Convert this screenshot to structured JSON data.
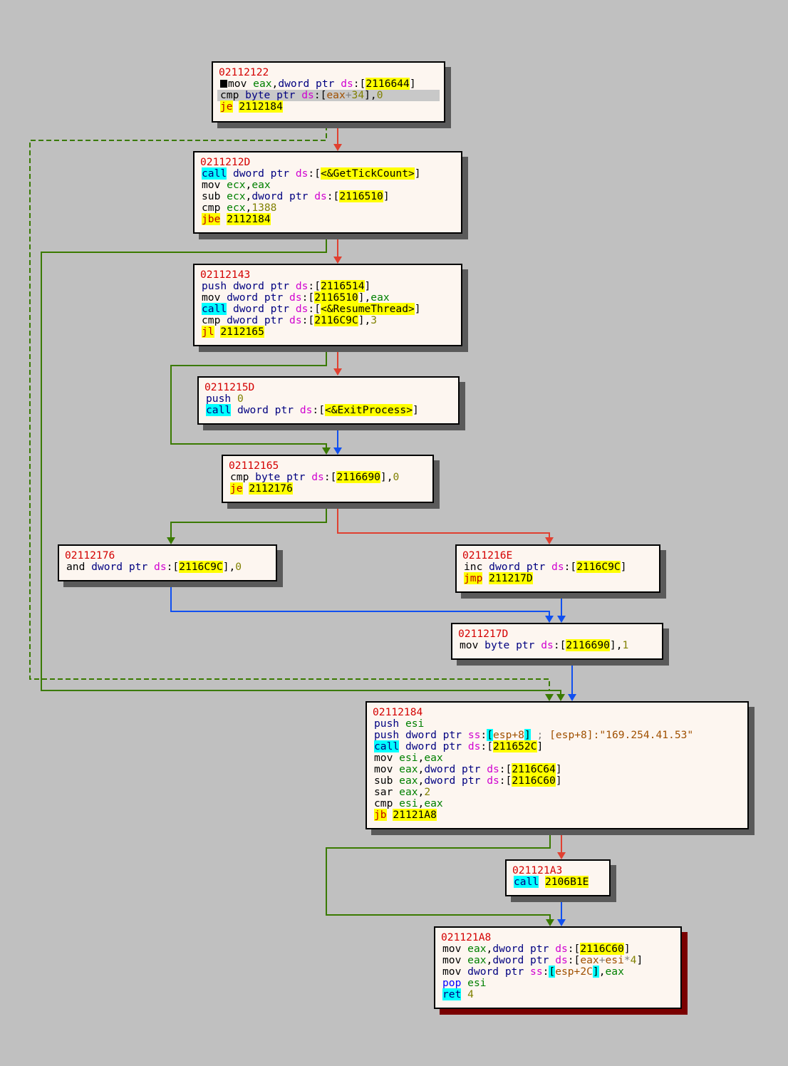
{
  "blocks": [
    {
      "id": "b0",
      "address": "02112122",
      "lines": [
        [
          {
            "t": "cursor"
          },
          {
            "c": "pl",
            "v": "mov "
          },
          {
            "c": "reg",
            "v": "eax"
          },
          {
            "c": "pl",
            "v": ","
          },
          {
            "c": "kw",
            "v": "dword ptr "
          },
          {
            "c": "seg",
            "v": "ds"
          },
          {
            "c": "pl",
            "v": ":["
          },
          {
            "c": "imm",
            "v": "2116644"
          },
          {
            "c": "pl",
            "v": "]"
          }
        ],
        [
          {
            "hl": true
          },
          {
            "c": "pl",
            "v": "cmp "
          },
          {
            "c": "kw",
            "v": "byte ptr "
          },
          {
            "c": "seg",
            "v": "ds"
          },
          {
            "c": "pl",
            "v": ":["
          },
          {
            "c": "str",
            "v": "eax"
          },
          {
            "c": "op",
            "v": "+"
          },
          {
            "c": "num",
            "v": "34"
          },
          {
            "c": "pl",
            "v": "],"
          },
          {
            "c": "num",
            "v": "0"
          }
        ],
        [
          {
            "c": "mn-y",
            "v": "je"
          },
          {
            "c": "pl",
            "v": " "
          },
          {
            "c": "imm",
            "v": "2112184"
          }
        ]
      ]
    },
    {
      "id": "b1",
      "address": "0211212D",
      "lines": [
        [
          {
            "c": "mn-c",
            "v": "call"
          },
          {
            "c": "pl",
            "v": " "
          },
          {
            "c": "kw",
            "v": "dword ptr "
          },
          {
            "c": "seg",
            "v": "ds"
          },
          {
            "c": "pl",
            "v": ":["
          },
          {
            "c": "sym",
            "v": "<&GetTickCount>"
          },
          {
            "c": "pl",
            "v": "]"
          }
        ],
        [
          {
            "c": "pl",
            "v": "mov "
          },
          {
            "c": "reg",
            "v": "ecx"
          },
          {
            "c": "pl",
            "v": ","
          },
          {
            "c": "reg",
            "v": "eax"
          }
        ],
        [
          {
            "c": "pl",
            "v": "sub "
          },
          {
            "c": "reg",
            "v": "ecx"
          },
          {
            "c": "pl",
            "v": ","
          },
          {
            "c": "kw",
            "v": "dword ptr "
          },
          {
            "c": "seg",
            "v": "ds"
          },
          {
            "c": "pl",
            "v": ":["
          },
          {
            "c": "imm",
            "v": "2116510"
          },
          {
            "c": "pl",
            "v": "]"
          }
        ],
        [
          {
            "c": "pl",
            "v": "cmp "
          },
          {
            "c": "reg",
            "v": "ecx"
          },
          {
            "c": "pl",
            "v": ","
          },
          {
            "c": "num",
            "v": "1388"
          }
        ],
        [
          {
            "c": "mn-y",
            "v": "jbe"
          },
          {
            "c": "pl",
            "v": " "
          },
          {
            "c": "imm",
            "v": "2112184"
          }
        ]
      ]
    },
    {
      "id": "b2",
      "address": "02112143",
      "lines": [
        [
          {
            "c": "mn",
            "v": "push"
          },
          {
            "c": "pl",
            "v": " "
          },
          {
            "c": "kw",
            "v": "dword ptr "
          },
          {
            "c": "seg",
            "v": "ds"
          },
          {
            "c": "pl",
            "v": ":["
          },
          {
            "c": "imm",
            "v": "2116514"
          },
          {
            "c": "pl",
            "v": "]"
          }
        ],
        [
          {
            "c": "pl",
            "v": "mov "
          },
          {
            "c": "kw",
            "v": "dword ptr "
          },
          {
            "c": "seg",
            "v": "ds"
          },
          {
            "c": "pl",
            "v": ":["
          },
          {
            "c": "imm",
            "v": "2116510"
          },
          {
            "c": "pl",
            "v": "],"
          },
          {
            "c": "reg",
            "v": "eax"
          }
        ],
        [
          {
            "c": "mn-c",
            "v": "call"
          },
          {
            "c": "pl",
            "v": " "
          },
          {
            "c": "kw",
            "v": "dword ptr "
          },
          {
            "c": "seg",
            "v": "ds"
          },
          {
            "c": "pl",
            "v": ":["
          },
          {
            "c": "sym",
            "v": "<&ResumeThread>"
          },
          {
            "c": "pl",
            "v": "]"
          }
        ],
        [
          {
            "c": "pl",
            "v": "cmp "
          },
          {
            "c": "kw",
            "v": "dword ptr "
          },
          {
            "c": "seg",
            "v": "ds"
          },
          {
            "c": "pl",
            "v": ":["
          },
          {
            "c": "imm",
            "v": "2116C9C"
          },
          {
            "c": "pl",
            "v": "],"
          },
          {
            "c": "num",
            "v": "3"
          }
        ],
        [
          {
            "c": "mn-y",
            "v": "jl"
          },
          {
            "c": "pl",
            "v": " "
          },
          {
            "c": "imm",
            "v": "2112165"
          }
        ]
      ]
    },
    {
      "id": "b3",
      "address": "0211215D",
      "lines": [
        [
          {
            "c": "mn",
            "v": "push"
          },
          {
            "c": "pl",
            "v": " "
          },
          {
            "c": "num",
            "v": "0"
          }
        ],
        [
          {
            "c": "mn-c",
            "v": "call"
          },
          {
            "c": "pl",
            "v": " "
          },
          {
            "c": "kw",
            "v": "dword ptr "
          },
          {
            "c": "seg",
            "v": "ds"
          },
          {
            "c": "pl",
            "v": ":["
          },
          {
            "c": "sym",
            "v": "<&ExitProcess>"
          },
          {
            "c": "pl",
            "v": "]"
          }
        ]
      ]
    },
    {
      "id": "b4",
      "address": "02112165",
      "lines": [
        [
          {
            "c": "pl",
            "v": "cmp "
          },
          {
            "c": "kw",
            "v": "byte ptr "
          },
          {
            "c": "seg",
            "v": "ds"
          },
          {
            "c": "pl",
            "v": ":["
          },
          {
            "c": "imm",
            "v": "2116690"
          },
          {
            "c": "pl",
            "v": "],"
          },
          {
            "c": "num",
            "v": "0"
          }
        ],
        [
          {
            "c": "mn-y",
            "v": "je"
          },
          {
            "c": "pl",
            "v": " "
          },
          {
            "c": "imm",
            "v": "2112176"
          }
        ]
      ]
    },
    {
      "id": "b5",
      "address": "02112176",
      "lines": [
        [
          {
            "c": "pl",
            "v": "and "
          },
          {
            "c": "kw",
            "v": "dword ptr "
          },
          {
            "c": "seg",
            "v": "ds"
          },
          {
            "c": "pl",
            "v": ":["
          },
          {
            "c": "imm",
            "v": "2116C9C"
          },
          {
            "c": "pl",
            "v": "],"
          },
          {
            "c": "num",
            "v": "0"
          }
        ]
      ]
    },
    {
      "id": "b6",
      "address": "0211216E",
      "lines": [
        [
          {
            "c": "pl",
            "v": "inc "
          },
          {
            "c": "kw",
            "v": "dword ptr "
          },
          {
            "c": "seg",
            "v": "ds"
          },
          {
            "c": "pl",
            "v": ":["
          },
          {
            "c": "imm",
            "v": "2116C9C"
          },
          {
            "c": "pl",
            "v": "]"
          }
        ],
        [
          {
            "c": "mn-y",
            "v": "jmp"
          },
          {
            "c": "pl",
            "v": " "
          },
          {
            "c": "imm",
            "v": "211217D"
          }
        ]
      ]
    },
    {
      "id": "b7",
      "address": "0211217D",
      "lines": [
        [
          {
            "c": "pl",
            "v": "mov "
          },
          {
            "c": "kw",
            "v": "byte ptr "
          },
          {
            "c": "seg",
            "v": "ds"
          },
          {
            "c": "pl",
            "v": ":["
          },
          {
            "c": "imm",
            "v": "2116690"
          },
          {
            "c": "pl",
            "v": "],"
          },
          {
            "c": "num",
            "v": "1"
          }
        ]
      ]
    },
    {
      "id": "b8",
      "address": "02112184",
      "lines": [
        [
          {
            "c": "mn",
            "v": "push"
          },
          {
            "c": "pl",
            "v": " "
          },
          {
            "c": "reg",
            "v": "esi"
          }
        ],
        [
          {
            "c": "mn",
            "v": "push"
          },
          {
            "c": "pl",
            "v": " "
          },
          {
            "c": "kw",
            "v": "dword ptr "
          },
          {
            "c": "seg",
            "v": "ss"
          },
          {
            "c": "pl",
            "v": ":"
          },
          {
            "c": "cyan",
            "v": "["
          },
          {
            "c": "str",
            "v": "esp+8"
          },
          {
            "c": "cyan",
            "v": "]"
          },
          {
            "c": "op",
            "v": " ; "
          },
          {
            "c": "str",
            "v": "[esp+8]:\"169.254.41.53\""
          }
        ],
        [
          {
            "c": "mn-c",
            "v": "call"
          },
          {
            "c": "pl",
            "v": " "
          },
          {
            "c": "kw",
            "v": "dword ptr "
          },
          {
            "c": "seg",
            "v": "ds"
          },
          {
            "c": "pl",
            "v": ":["
          },
          {
            "c": "imm",
            "v": "211652C"
          },
          {
            "c": "pl",
            "v": "]"
          }
        ],
        [
          {
            "c": "pl",
            "v": "mov "
          },
          {
            "c": "reg",
            "v": "esi"
          },
          {
            "c": "pl",
            "v": ","
          },
          {
            "c": "reg",
            "v": "eax"
          }
        ],
        [
          {
            "c": "pl",
            "v": "mov "
          },
          {
            "c": "reg",
            "v": "eax"
          },
          {
            "c": "pl",
            "v": ","
          },
          {
            "c": "kw",
            "v": "dword ptr "
          },
          {
            "c": "seg",
            "v": "ds"
          },
          {
            "c": "pl",
            "v": ":["
          },
          {
            "c": "imm",
            "v": "2116C64"
          },
          {
            "c": "pl",
            "v": "]"
          }
        ],
        [
          {
            "c": "pl",
            "v": "sub "
          },
          {
            "c": "reg",
            "v": "eax"
          },
          {
            "c": "pl",
            "v": ","
          },
          {
            "c": "kw",
            "v": "dword ptr "
          },
          {
            "c": "seg",
            "v": "ds"
          },
          {
            "c": "pl",
            "v": ":["
          },
          {
            "c": "imm",
            "v": "2116C60"
          },
          {
            "c": "pl",
            "v": "]"
          }
        ],
        [
          {
            "c": "pl",
            "v": "sar "
          },
          {
            "c": "reg",
            "v": "eax"
          },
          {
            "c": "pl",
            "v": ","
          },
          {
            "c": "num",
            "v": "2"
          }
        ],
        [
          {
            "c": "pl",
            "v": "cmp "
          },
          {
            "c": "reg",
            "v": "esi"
          },
          {
            "c": "pl",
            "v": ","
          },
          {
            "c": "reg",
            "v": "eax"
          }
        ],
        [
          {
            "c": "mn-y",
            "v": "jb"
          },
          {
            "c": "pl",
            "v": " "
          },
          {
            "c": "imm",
            "v": "21121A8"
          }
        ]
      ]
    },
    {
      "id": "b9",
      "address": "021121A3",
      "lines": [
        [
          {
            "c": "mn-c",
            "v": "call"
          },
          {
            "c": "pl",
            "v": " "
          },
          {
            "c": "imm",
            "v": "2106B1E"
          }
        ]
      ]
    },
    {
      "id": "b10",
      "address": "021121A8",
      "final": true,
      "lines": [
        [
          {
            "c": "pl",
            "v": "mov "
          },
          {
            "c": "reg",
            "v": "eax"
          },
          {
            "c": "pl",
            "v": ","
          },
          {
            "c": "kw",
            "v": "dword ptr "
          },
          {
            "c": "seg",
            "v": "ds"
          },
          {
            "c": "pl",
            "v": ":["
          },
          {
            "c": "imm",
            "v": "2116C60"
          },
          {
            "c": "pl",
            "v": "]"
          }
        ],
        [
          {
            "c": "pl",
            "v": "mov "
          },
          {
            "c": "reg",
            "v": "eax"
          },
          {
            "c": "pl",
            "v": ","
          },
          {
            "c": "kw",
            "v": "dword ptr "
          },
          {
            "c": "seg",
            "v": "ds"
          },
          {
            "c": "pl",
            "v": ":["
          },
          {
            "c": "str",
            "v": "eax"
          },
          {
            "c": "op",
            "v": "+"
          },
          {
            "c": "str",
            "v": "esi"
          },
          {
            "c": "op",
            "v": "*"
          },
          {
            "c": "num",
            "v": "4"
          },
          {
            "c": "pl",
            "v": "]"
          }
        ],
        [
          {
            "c": "pl",
            "v": "mov "
          },
          {
            "c": "kw",
            "v": "dword ptr "
          },
          {
            "c": "seg",
            "v": "ss"
          },
          {
            "c": "pl",
            "v": ":"
          },
          {
            "c": "cyan",
            "v": "["
          },
          {
            "c": "str",
            "v": "esp+2C"
          },
          {
            "c": "cyan",
            "v": "]"
          },
          {
            "c": "pl",
            "v": ","
          },
          {
            "c": "reg",
            "v": "eax"
          }
        ],
        [
          {
            "c": "mn-pop",
            "v": "pop"
          },
          {
            "c": "pl",
            "v": " "
          },
          {
            "c": "reg",
            "v": "esi"
          }
        ],
        [
          {
            "c": "mn-r",
            "v": "ret"
          },
          {
            "c": "pl",
            "v": " "
          },
          {
            "c": "num",
            "v": "4"
          }
        ]
      ]
    }
  ],
  "colors": {
    "background": "#c0c0c0",
    "block_fill": "#fdf6f0",
    "edge_true_taken": "#3a7a00",
    "edge_fallthrough": "#e04030",
    "edge_unconditional": "#1050f0",
    "return_shadow": "#7a0000"
  }
}
